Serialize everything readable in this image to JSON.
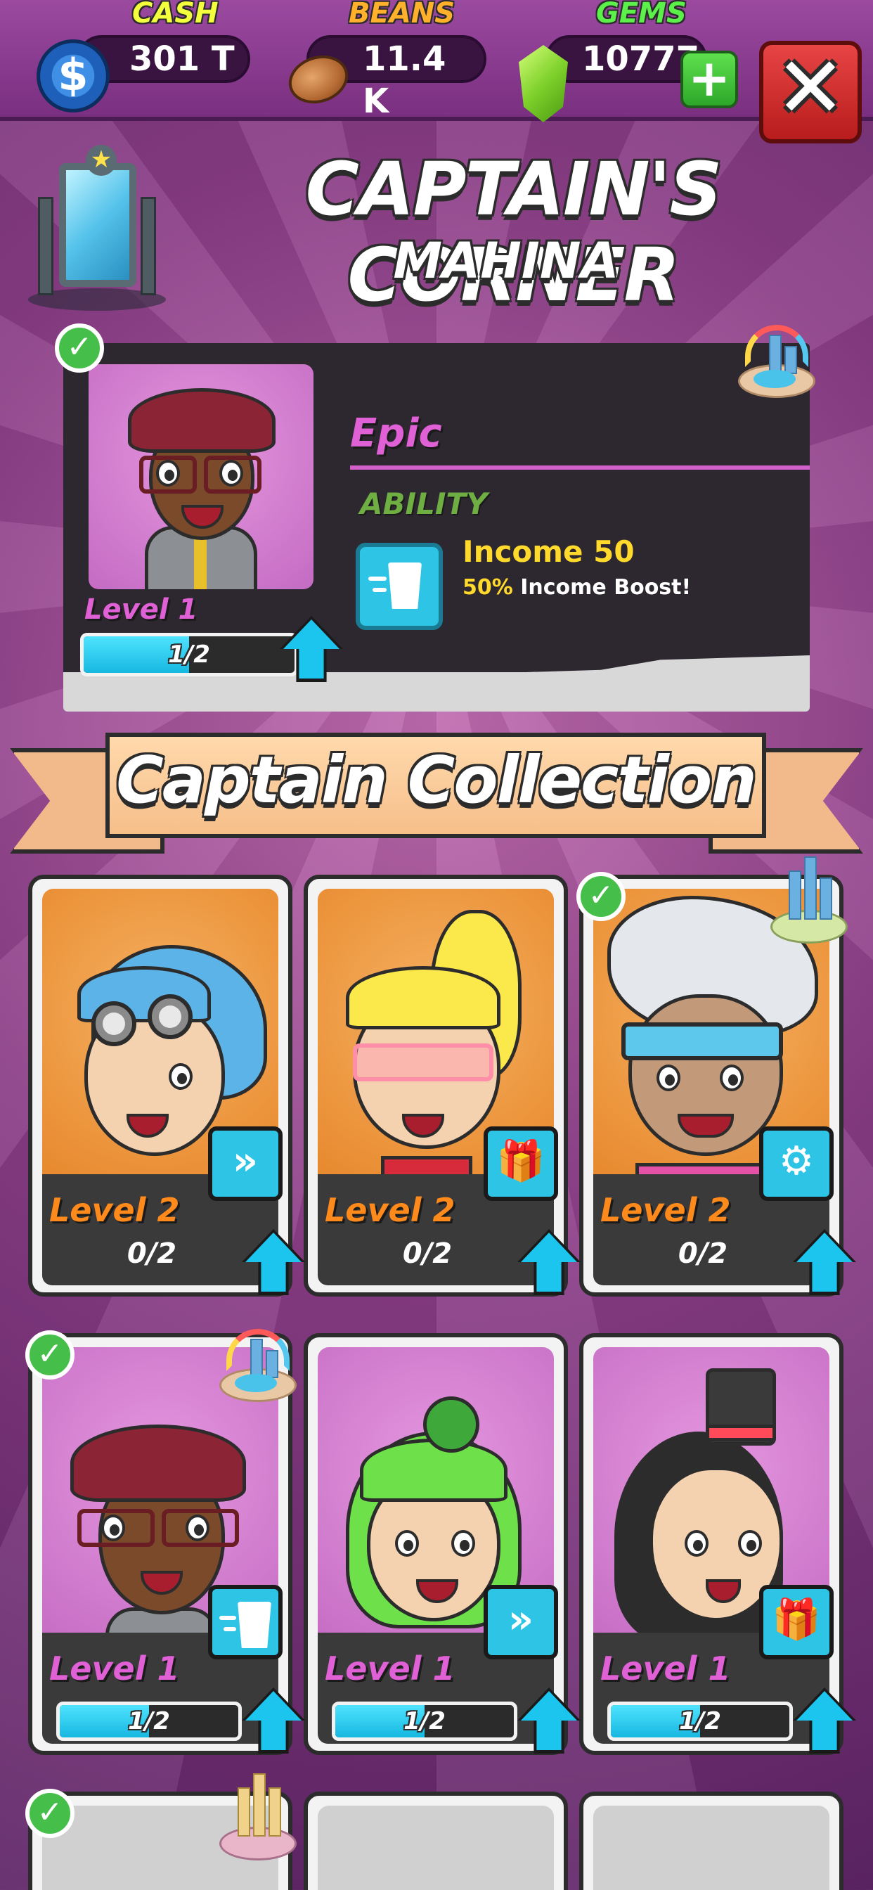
{
  "resources": {
    "cash": {
      "label": "CASH",
      "value": "301 T",
      "icon": "dollar-coin-icon",
      "symbol": "$",
      "color": "#f3ff3d"
    },
    "beans": {
      "label": "BEANS",
      "value": "11.4 K",
      "icon": "coffee-bean-icon",
      "color": "#ffb12b"
    },
    "gems": {
      "label": "GEMS",
      "value": "10777",
      "icon": "green-gem-icon",
      "color": "#5cf04a"
    }
  },
  "buttons": {
    "add_gems": "+",
    "close": "✕"
  },
  "header": {
    "title": "CAPTAIN'S CORNER",
    "subtitle": "MAHINA"
  },
  "featured": {
    "rarity": "Epic",
    "ability_label": "ABILITY",
    "ability_title": "Income 50",
    "ability_pct": "50%",
    "ability_desc": " Income Boost!",
    "level": "Level 1",
    "progress_text": "1/2",
    "progress": 0.5,
    "selected": true,
    "check": "✓",
    "location_badge": "resort-island-icon"
  },
  "collection": {
    "title": "Captain Collection",
    "cards": [
      {
        "level": "Level 2",
        "progress_text": "0/2",
        "progress": 0,
        "ability_icon": "fast-forward-icon",
        "glyph": "»",
        "bg": "orange",
        "selected": false
      },
      {
        "level": "Level 2",
        "progress_text": "0/2",
        "progress": 0,
        "ability_icon": "gift-box-icon",
        "glyph": "🎁",
        "bg": "orange",
        "selected": false
      },
      {
        "level": "Level 2",
        "progress_text": "0/2",
        "progress": 0,
        "ability_icon": "robot-arm-icon",
        "glyph": "⚙",
        "bg": "orange",
        "selected": true,
        "badge": "city-island-icon"
      },
      {
        "level": "Level 1",
        "progress_text": "1/2",
        "progress": 0.5,
        "ability_icon": "income-cup-icon",
        "glyph": "",
        "bg": "pink",
        "selected": true,
        "badge": "resort-island-icon"
      },
      {
        "level": "Level 1",
        "progress_text": "1/2",
        "progress": 0.5,
        "ability_icon": "fast-forward-icon",
        "glyph": "»",
        "bg": "pink",
        "selected": false
      },
      {
        "level": "Level 1",
        "progress_text": "1/2",
        "progress": 0.5,
        "ability_icon": "gift-box-icon",
        "glyph": "🎁",
        "bg": "pink",
        "selected": false
      }
    ]
  },
  "colors": {
    "orange_level": "#ff8a1c",
    "pink_level": "#e060d6",
    "progress_fill": "#16b8e0",
    "check_green": "#46bf4a"
  }
}
